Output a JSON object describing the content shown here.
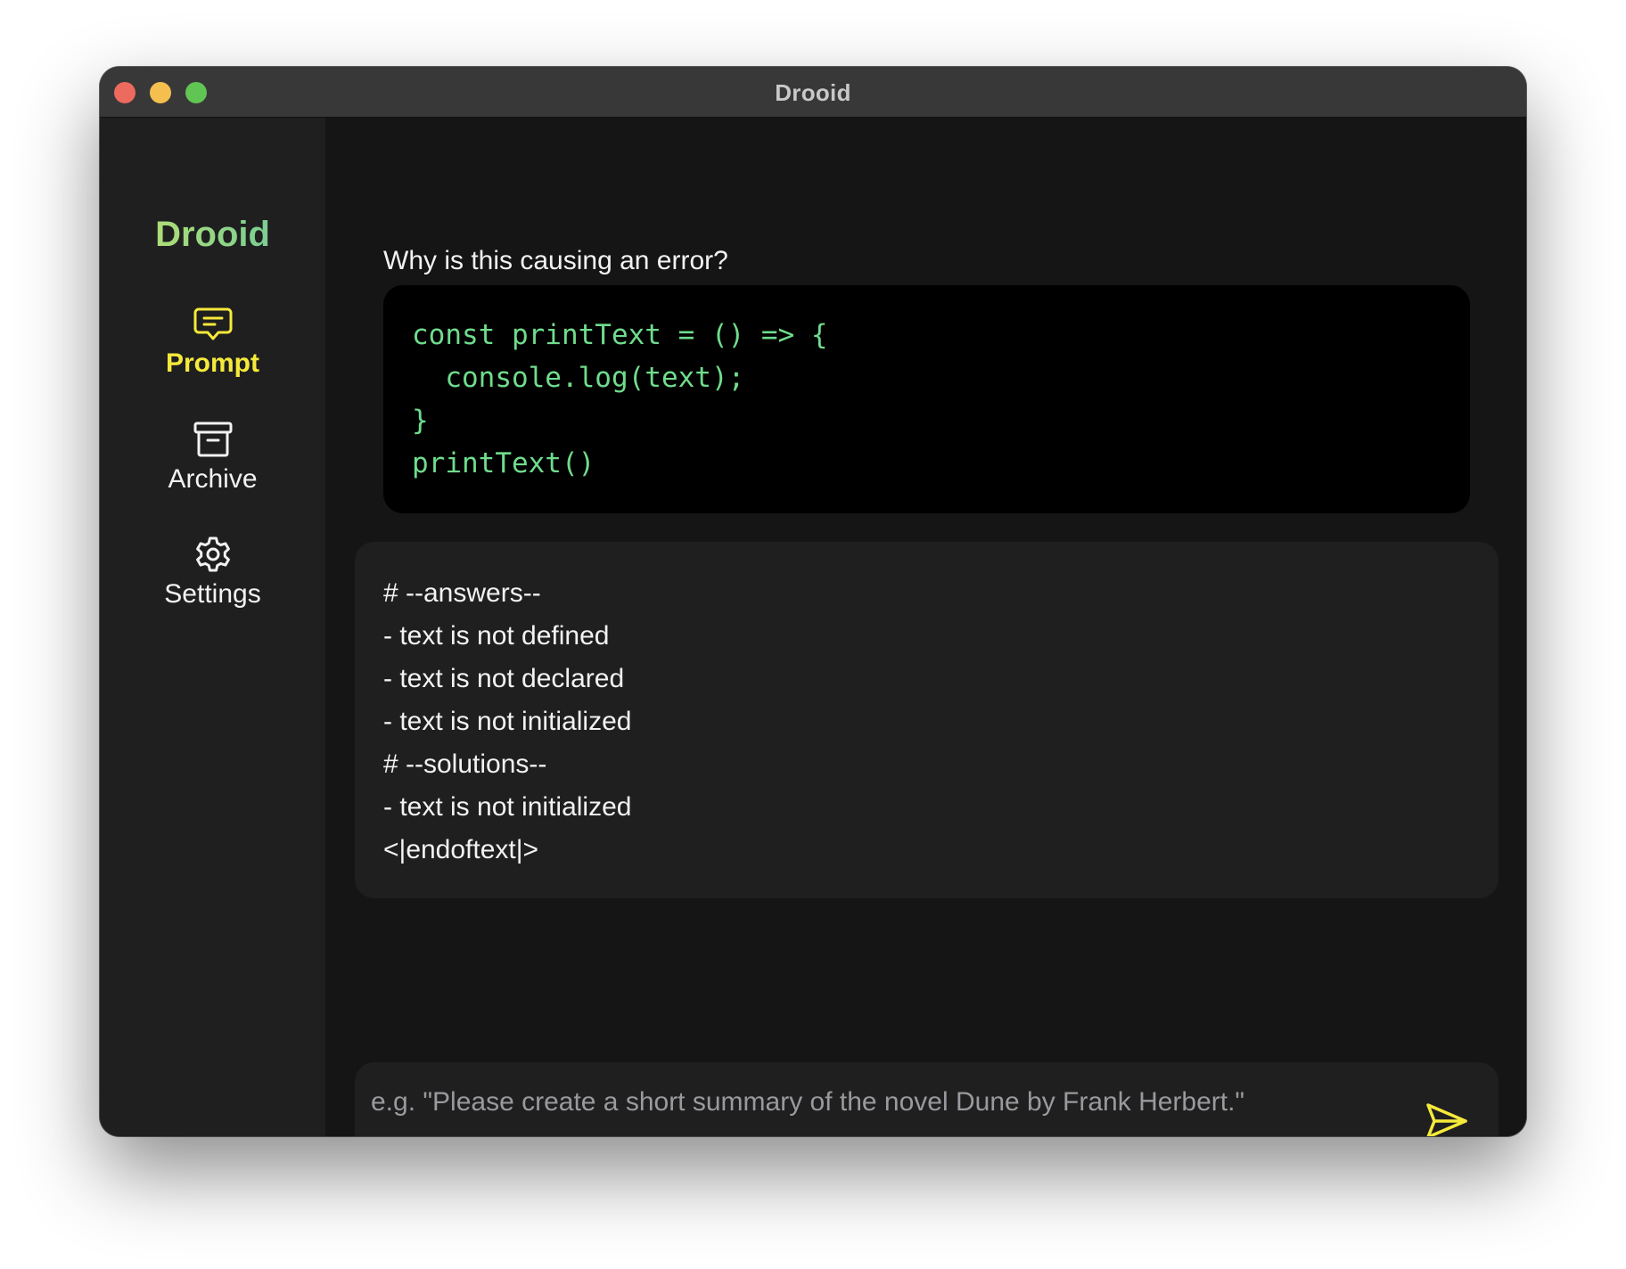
{
  "window": {
    "title": "Drooid"
  },
  "sidebar": {
    "brand": "Drooid",
    "items": [
      {
        "label": "Prompt",
        "icon": "chat-bubble-icon",
        "active": true
      },
      {
        "label": "Archive",
        "icon": "archive-box-icon",
        "active": false
      },
      {
        "label": "Settings",
        "icon": "gear-icon",
        "active": false
      }
    ]
  },
  "conversation": {
    "question": "Why is this causing an error?",
    "code_lines": [
      "const printText = () => {",
      "  console.log(text);",
      "}",
      "printText()"
    ],
    "answer_lines": [
      "# --answers--",
      "- text is not defined",
      "- text is not declared",
      "- text is not initialized",
      "# --solutions--",
      "- text is not initialized",
      "<|endoftext|>"
    ]
  },
  "prompt": {
    "value": "",
    "placeholder": "e.g. \"Please create a short summary of the novel Dune by Frank Herbert.\"",
    "send_icon": "send-icon"
  },
  "colors": {
    "accent": "#f5ea3a",
    "code_text": "#6fdc8c",
    "brand_gradient_start": "#c8e46a",
    "brand_gradient_end": "#7db9c5"
  }
}
